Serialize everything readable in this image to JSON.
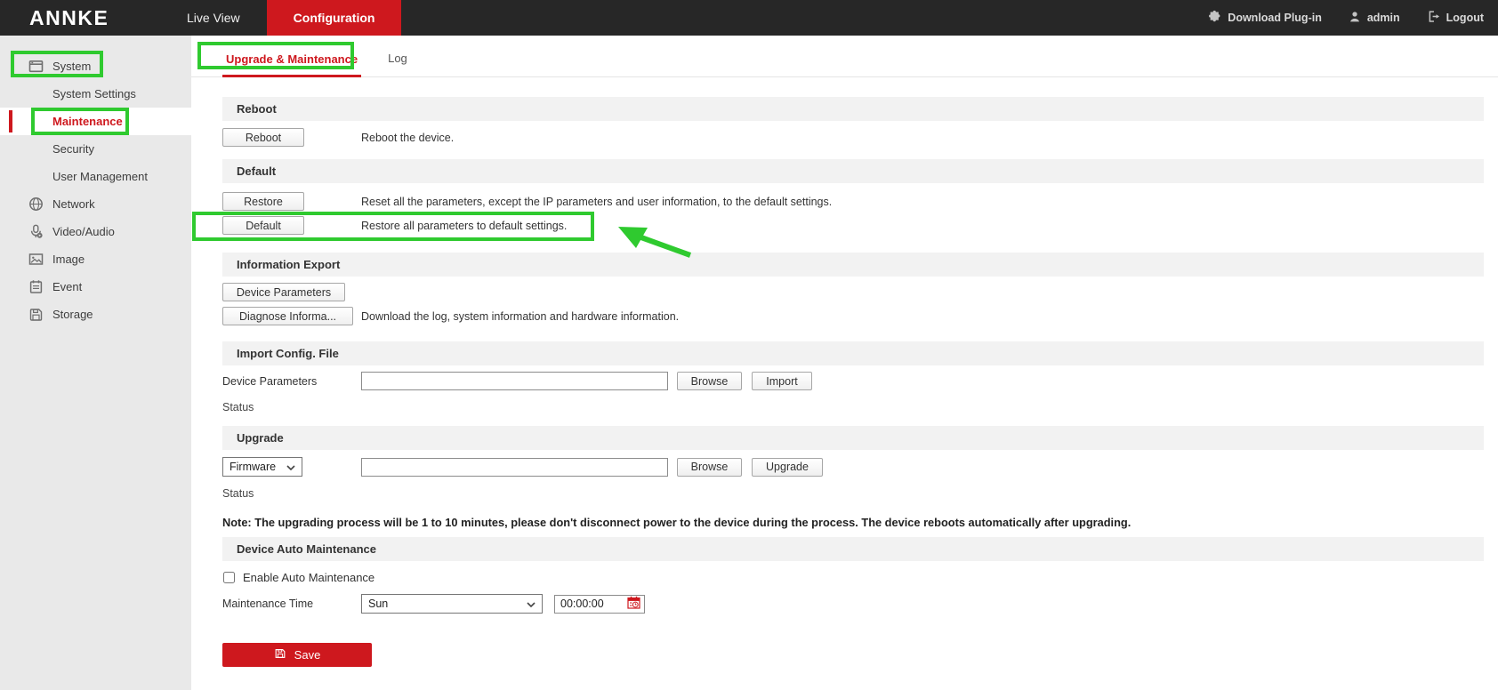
{
  "topbar": {
    "brand": "ANNKE",
    "nav": [
      {
        "label": "Live View",
        "active": false
      },
      {
        "label": "Configuration",
        "active": true
      }
    ],
    "actions": {
      "download_plugin": "Download Plug-in",
      "user": "admin",
      "logout": "Logout"
    }
  },
  "sidebar": {
    "items": [
      {
        "label": "System",
        "icon": "system-icon",
        "type": "top"
      },
      {
        "label": "System Settings",
        "type": "sub"
      },
      {
        "label": "Maintenance",
        "type": "sub",
        "active": true
      },
      {
        "label": "Security",
        "type": "sub"
      },
      {
        "label": "User Management",
        "type": "sub"
      },
      {
        "label": "Network",
        "icon": "network-icon",
        "type": "top"
      },
      {
        "label": "Video/Audio",
        "icon": "video-audio-icon",
        "type": "top"
      },
      {
        "label": "Image",
        "icon": "image-icon",
        "type": "top"
      },
      {
        "label": "Event",
        "icon": "event-icon",
        "type": "top"
      },
      {
        "label": "Storage",
        "icon": "storage-icon",
        "type": "top"
      }
    ]
  },
  "tabs": {
    "upgrade_maintenance": "Upgrade & Maintenance",
    "log": "Log"
  },
  "sections": {
    "reboot": {
      "title": "Reboot",
      "button": "Reboot",
      "desc": "Reboot the device."
    },
    "default": {
      "title": "Default",
      "restore_button": "Restore",
      "restore_desc": "Reset all the parameters, except the IP parameters and user information, to the default settings.",
      "default_button": "Default",
      "default_desc": "Restore all parameters to default settings."
    },
    "information_export": {
      "title": "Information Export",
      "device_parameters_button": "Device Parameters",
      "diagnose_button": "Diagnose Informa...",
      "diagnose_desc": "Download the log, system information and hardware information."
    },
    "import_config": {
      "title": "Import Config. File",
      "label": "Device Parameters",
      "input_value": "",
      "browse_button": "Browse",
      "import_button": "Import",
      "status_label": "Status"
    },
    "upgrade": {
      "title": "Upgrade",
      "type_select": "Firmware",
      "input_value": "",
      "browse_button": "Browse",
      "upgrade_button": "Upgrade",
      "status_label": "Status",
      "note": "Note: The upgrading process will be 1 to 10 minutes, please don't disconnect power to the device during the process. The device reboots automatically after upgrading."
    },
    "auto_maintenance": {
      "title": "Device Auto Maintenance",
      "enable_label": "Enable Auto Maintenance",
      "enable_checked": false,
      "time_label": "Maintenance Time",
      "day_select": "Sun",
      "time_value": "00:00:00"
    }
  },
  "save_button": "Save",
  "colors": {
    "accent_red": "#ce181e",
    "annotation_green": "#2fca2f",
    "topbar_bg": "#272727",
    "sidebar_bg": "#e9e9e9",
    "band_bg": "#f2f2f2"
  }
}
